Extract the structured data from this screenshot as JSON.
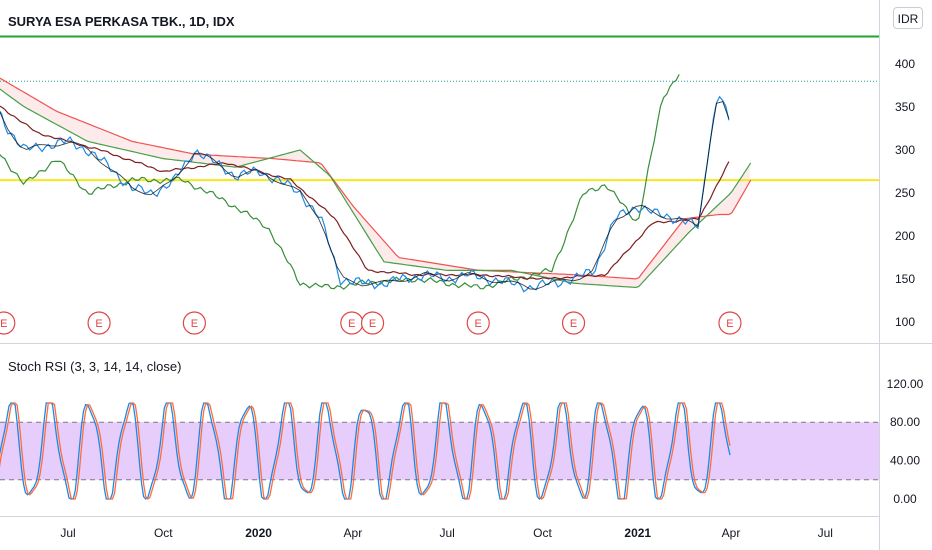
{
  "header": {
    "title": "SURYA ESA PERKASA TBK., 1D, IDX",
    "currency": "IDR"
  },
  "colors": {
    "price_line": "#1e88e5",
    "close_line": "#000000",
    "base_line": "#7b1f1f",
    "span_a": "#43a047",
    "span_b": "#ef5350",
    "lagging": "#388e3c",
    "resistance": "#22a333",
    "support": "#f5e91b",
    "stoch_k": "#1e88e5",
    "stoch_d": "#ff6d3a",
    "band_fill": "#e4c8fb",
    "earnings": "#e04646"
  },
  "chart_data": [
    {
      "type": "line",
      "title": "SURYA ESA PERKASA TBK., 1D, IDX",
      "y_axis": {
        "ticks": [
          "100",
          "150",
          "200",
          "250",
          "300",
          "350",
          "400"
        ],
        "range": [
          85,
          420
        ]
      },
      "x_axis": {
        "ticks": [
          "Jul",
          "Oct",
          "2020",
          "Apr",
          "Jul",
          "Oct",
          "2021",
          "Apr",
          "Jul"
        ],
        "bold_ticks": [
          "2020",
          "2021"
        ]
      },
      "horizontal_levels": [
        {
          "name": "",
          "value": 432,
          "color": "#22a333"
        },
        {
          "name": "",
          "value": 265,
          "color": "#f5e91b"
        },
        {
          "name": "",
          "value": 380,
          "color": "#26a69a",
          "style": "dotted"
        }
      ],
      "earnings_markers": {
        "label": "E",
        "dates": [
          "2019-04-30",
          "2019-07-31",
          "2019-10-31",
          "2020-03-31",
          "2020-04-20",
          "2020-07-31",
          "2020-10-31",
          "2021-03-31"
        ]
      },
      "series": [
        {
          "role": "price",
          "x": [
            "2019-04-10",
            "2019-05-01",
            "2019-05-20",
            "2019-06-10",
            "2019-07-01",
            "2019-07-20",
            "2019-08-10",
            "2019-09-01",
            "2019-09-20",
            "2019-10-10",
            "2019-11-01",
            "2019-11-20",
            "2019-12-10",
            "2020-01-01",
            "2020-01-20",
            "2020-02-10",
            "2020-03-01",
            "2020-03-20",
            "2020-04-10",
            "2020-05-01",
            "2020-05-20",
            "2020-06-10",
            "2020-07-01",
            "2020-07-20",
            "2020-08-10",
            "2020-09-01",
            "2020-09-20",
            "2020-10-10",
            "2020-11-01",
            "2020-11-20",
            "2020-12-10",
            "2021-01-01",
            "2021-01-20",
            "2021-02-10",
            "2021-03-01",
            "2021-03-10",
            "2021-03-20",
            "2021-03-31"
          ],
          "values": [
            385,
            330,
            300,
            305,
            310,
            300,
            280,
            255,
            250,
            262,
            300,
            285,
            270,
            275,
            265,
            250,
            220,
            150,
            145,
            145,
            150,
            155,
            150,
            155,
            150,
            145,
            140,
            145,
            150,
            160,
            220,
            235,
            225,
            220,
            210,
            300,
            370,
            330
          ]
        },
        {
          "role": "base-line",
          "x": [
            "2019-04-10",
            "2019-06-01",
            "2019-08-01",
            "2019-10-01",
            "2019-12-01",
            "2020-02-01",
            "2020-03-15",
            "2020-04-15",
            "2020-06-01",
            "2020-08-01",
            "2020-10-01",
            "2020-12-01",
            "2021-01-15",
            "2021-03-01",
            "2021-04-01"
          ],
          "values": [
            365,
            320,
            300,
            275,
            285,
            265,
            220,
            160,
            155,
            155,
            150,
            155,
            215,
            220,
            290
          ]
        },
        {
          "role": "leading-span-a",
          "x": [
            "2019-04-10",
            "2019-05-20",
            "2019-07-20",
            "2019-10-01",
            "2019-12-10",
            "2020-02-10",
            "2020-03-10",
            "2020-05-01",
            "2020-07-01",
            "2020-09-01",
            "2020-11-01",
            "2021-01-01",
            "2021-02-20",
            "2021-04-01",
            "2021-04-20"
          ],
          "values": [
            385,
            350,
            310,
            290,
            280,
            300,
            270,
            170,
            160,
            160,
            145,
            140,
            205,
            250,
            285
          ]
        },
        {
          "role": "leading-span-b",
          "x": [
            "2019-04-10",
            "2019-06-20",
            "2019-09-01",
            "2019-11-01",
            "2020-01-15",
            "2020-03-01",
            "2020-04-01",
            "2020-05-15",
            "2020-08-01",
            "2020-11-01",
            "2021-01-01",
            "2021-02-15",
            "2021-03-20",
            "2021-04-01",
            "2021-04-20"
          ],
          "values": [
            395,
            345,
            310,
            295,
            290,
            285,
            235,
            175,
            160,
            155,
            150,
            220,
            225,
            225,
            265
          ]
        },
        {
          "role": "lagging-span",
          "x": [
            "2019-04-10",
            "2019-05-20",
            "2019-06-20",
            "2019-07-20",
            "2019-09-01",
            "2019-10-20",
            "2019-12-01",
            "2020-01-10",
            "2020-02-10",
            "2020-03-10",
            "2020-04-10",
            "2020-06-01",
            "2020-08-01",
            "2020-10-10",
            "2020-11-10",
            "2020-12-01",
            "2021-01-01",
            "2021-01-25",
            "2021-02-10"
          ],
          "values": [
            320,
            260,
            290,
            250,
            265,
            265,
            240,
            210,
            145,
            140,
            145,
            150,
            140,
            160,
            250,
            260,
            215,
            360,
            390
          ]
        }
      ]
    },
    {
      "type": "line",
      "title": "Stoch RSI (3, 3, 14, 14, close)",
      "y_axis": {
        "ticks": [
          "0.00",
          "40.00",
          "80.00",
          "120.00"
        ],
        "range": [
          -10,
          125
        ]
      },
      "bands": {
        "upper": 80,
        "lower": 20
      },
      "series": [
        {
          "name": "K",
          "period_days": 38,
          "start": "2019-03-20",
          "end": "2021-03-31"
        },
        {
          "name": "D",
          "period_days": 38,
          "start": "2019-03-20",
          "end": "2021-03-31"
        }
      ]
    }
  ]
}
